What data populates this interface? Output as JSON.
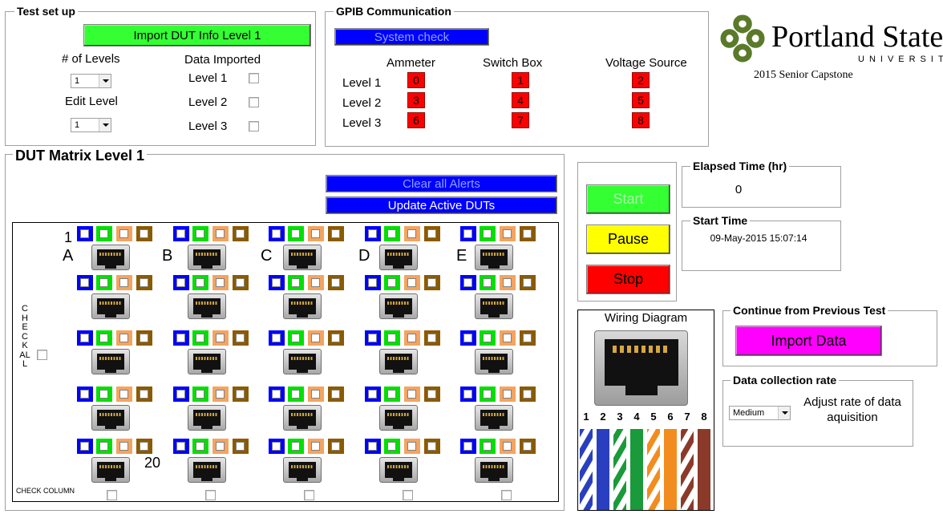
{
  "test_setup": {
    "title": "Test set up",
    "import_button": "Import DUT Info Level 1",
    "num_levels_label": "# of Levels",
    "num_levels_value": "1",
    "edit_level_label": "Edit Level",
    "edit_level_value": "1",
    "data_imported_label": "Data Imported",
    "levels": [
      "Level 1",
      "Level 2",
      "Level 3"
    ]
  },
  "gpib": {
    "title": "GPIB Communication",
    "system_check": "System check",
    "columns": [
      "Ammeter",
      "Switch Box",
      "Voltage Source"
    ],
    "rows": [
      {
        "label": "Level 1",
        "values": [
          "0",
          "1",
          "2"
        ]
      },
      {
        "label": "Level 2",
        "values": [
          "3",
          "4",
          "5"
        ]
      },
      {
        "label": "Level 3",
        "values": [
          "6",
          "7",
          "8"
        ]
      }
    ]
  },
  "logo": {
    "name": "Portland State",
    "sub": "UNIVERSITY",
    "caption": "2015 Senior Capstone",
    "color": "#5a7a2a"
  },
  "matrix": {
    "title": "DUT Matrix Level 1",
    "clear_alerts": "Clear all Alerts",
    "update_active": "Update Active DUTs",
    "first_index": "1",
    "last_index": "20",
    "column_letters": [
      "A",
      "B",
      "C",
      "D",
      "E"
    ],
    "check_all_label": "CHECK ALL",
    "check_column_label": "CHECK COLUMN",
    "indicator_colors": [
      "#0000ff",
      "#00e000",
      "#f4a460",
      "#8b5a00"
    ]
  },
  "controls": {
    "start": "Start",
    "pause": "Pause",
    "stop": "Stop"
  },
  "elapsed": {
    "title": "Elapsed Time (hr)",
    "value": "0"
  },
  "start_time": {
    "title": "Start Time",
    "value": "09-May-2015 15:07:14"
  },
  "wiring": {
    "title": "Wiring Diagram",
    "pins": [
      "1",
      "2",
      "3",
      "4",
      "5",
      "6",
      "7",
      "8"
    ]
  },
  "continue": {
    "title": "Continue from Previous Test",
    "import_data": "Import Data"
  },
  "rate": {
    "title": "Data collection rate",
    "value": "Medium",
    "description": "Adjust rate of data aquisition"
  }
}
